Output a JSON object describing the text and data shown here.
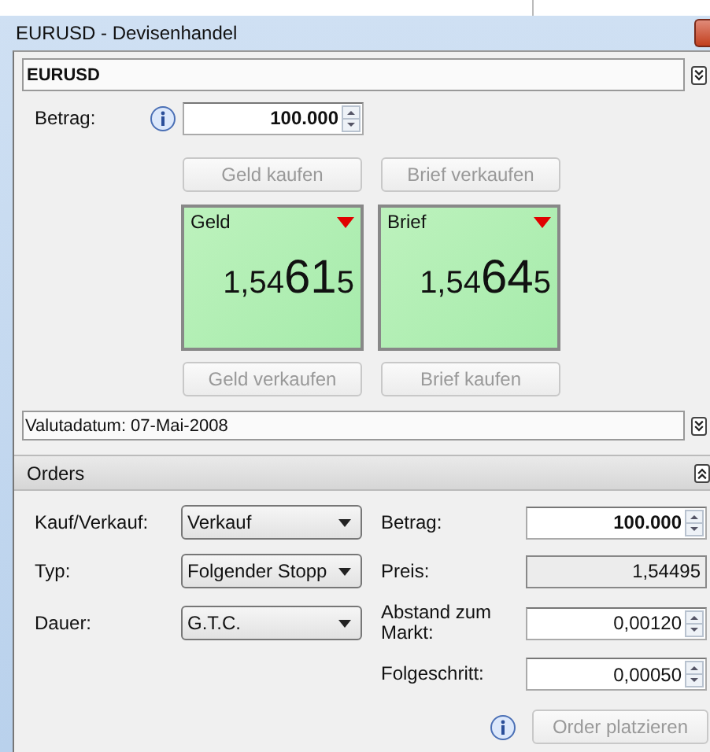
{
  "window": {
    "title": "EURUSD - Devisenhandel"
  },
  "instrument": {
    "name": "EURUSD",
    "expanded": false
  },
  "amount": {
    "label": "Betrag:",
    "value": "100.000",
    "bold": true
  },
  "buttons_top": [
    {
      "label": "Geld kaufen",
      "disabled": true
    },
    {
      "label": "Brief verkaufen",
      "disabled": true
    }
  ],
  "quotes": [
    {
      "label": "Geld",
      "prefix": "1,54",
      "pips": "61",
      "suffix": "5",
      "falling": true
    },
    {
      "label": "Brief",
      "prefix": "1,54",
      "pips": "64",
      "suffix": "5",
      "falling": true
    }
  ],
  "buttons_bottom": [
    {
      "label": "Geld verkaufen",
      "disabled": true
    },
    {
      "label": "Brief kaufen",
      "disabled": true
    }
  ],
  "value_date": {
    "text": "Valutadatum: 07-Mai-2008",
    "expanded": false
  },
  "orders": {
    "title": "Orders",
    "expanded": true,
    "left": [
      {
        "label": "Kauf/Verkauf:",
        "value": "Verkauf",
        "kind": "combo"
      },
      {
        "label": "Typ:",
        "value": "Folgender Stopp",
        "kind": "combo"
      },
      {
        "label": "Dauer:",
        "value": "G.T.C.",
        "kind": "combo"
      }
    ],
    "right": [
      {
        "label": "Betrag:",
        "value": "100.000",
        "kind": "spin",
        "bold": true
      },
      {
        "label": "Preis:",
        "value": "1,54495",
        "kind": "readonly",
        "bold": false
      },
      {
        "label": "Abstand zum Markt:",
        "value": "0,00120",
        "kind": "spin",
        "bold": false
      },
      {
        "label": "Folgeschritt:",
        "value": "0,00050",
        "kind": "spin",
        "bold": false
      }
    ],
    "submit": {
      "label": "Order platzieren",
      "disabled": true
    }
  }
}
